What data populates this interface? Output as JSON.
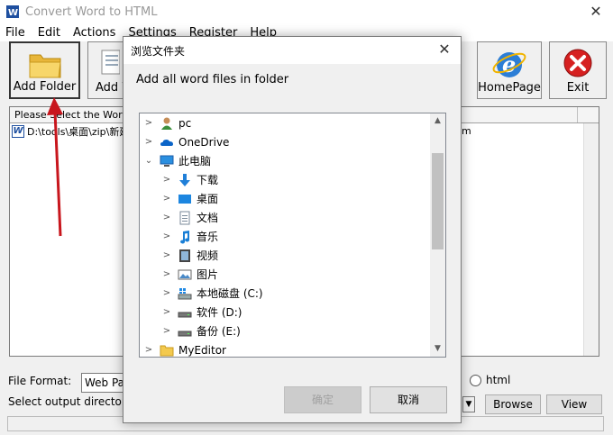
{
  "window": {
    "title": "Convert Word to HTML",
    "close_glyph": "✕"
  },
  "menu": [
    "File",
    "Edit",
    "Actions",
    "Settings",
    "Register",
    "Help"
  ],
  "toolbar": {
    "add_folder": "Add Folder",
    "add_word": "Add W",
    "homepage": "HomePage",
    "exit": "Exit"
  },
  "list": {
    "header": "Please Select the Word F",
    "rows": [
      {
        "path": "D:\\tools\\桌面\\zip\\新建",
        "suffix": "m"
      }
    ]
  },
  "bottom": {
    "file_format_label": "File Format:",
    "file_format_value": "Web Pa",
    "radio_html": "html",
    "output_dir_label": "Select  output directory:",
    "browse": "Browse",
    "view": "View"
  },
  "dialog": {
    "title": "浏览文件夹",
    "close_glyph": "✕",
    "description": "Add all word files in folder",
    "tree": [
      {
        "label": "pc",
        "icon": "user-icon"
      },
      {
        "label": "OneDrive",
        "icon": "cloud-icon"
      },
      {
        "label": "此电脑",
        "icon": "computer-icon"
      },
      {
        "label": "下载",
        "icon": "download-icon"
      },
      {
        "label": "桌面",
        "icon": "desktop-icon"
      },
      {
        "label": "文档",
        "icon": "document-icon"
      },
      {
        "label": "音乐",
        "icon": "music-icon"
      },
      {
        "label": "视频",
        "icon": "video-icon"
      },
      {
        "label": "图片",
        "icon": "picture-icon"
      },
      {
        "label": "本地磁盘 (C:)",
        "icon": "drive-c-icon"
      },
      {
        "label": "软件 (D:)",
        "icon": "drive-icon"
      },
      {
        "label": "备份 (E:)",
        "icon": "drive-icon"
      },
      {
        "label": "MyEditor",
        "icon": "folder-icon"
      }
    ],
    "ok": "确定",
    "cancel": "取消"
  },
  "colors": {
    "accent_selected": "#cce8ff",
    "arrow": "#c8161d",
    "folder": "#f3c94e"
  }
}
